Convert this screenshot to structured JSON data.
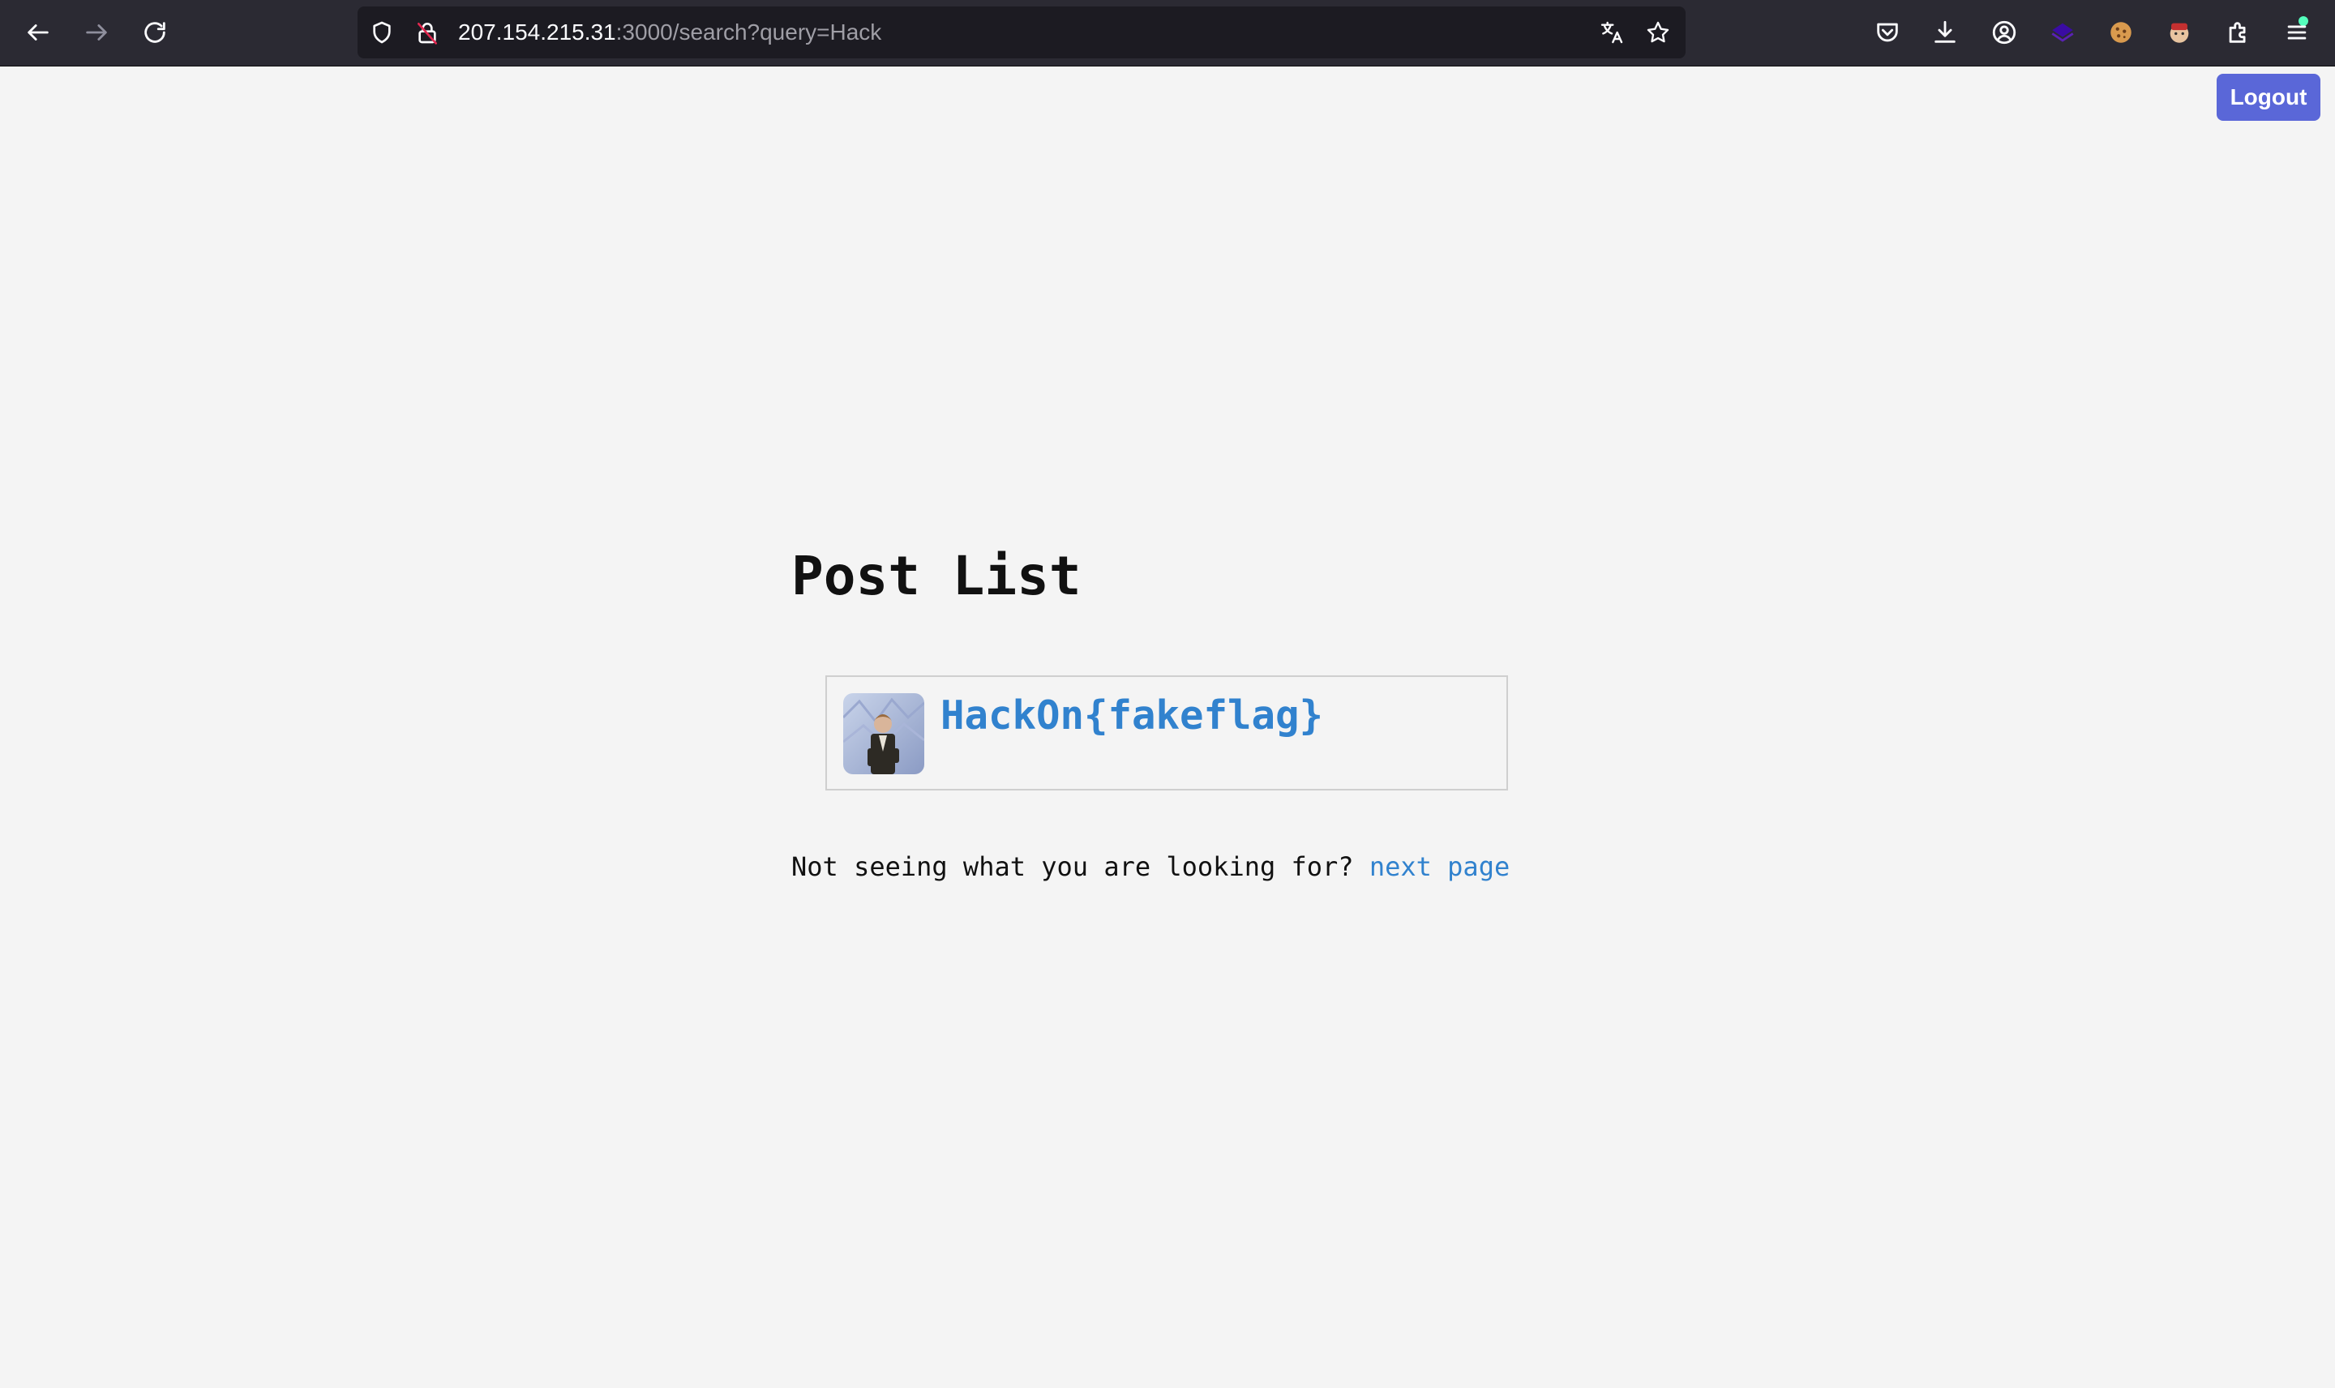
{
  "browser": {
    "url_host": "207.154.215.31",
    "url_rest": ":3000/search?query=Hack",
    "icons": {
      "back": "back-arrow-icon",
      "forward": "forward-arrow-icon",
      "reload": "reload-icon",
      "tracking": "shield-icon",
      "security": "insecure-lock-icon",
      "translate": "translate-icon",
      "bookmark": "star-icon",
      "pocket": "pocket-icon",
      "downloads": "download-icon",
      "account": "account-icon",
      "extensions": [
        "extension-layers-icon",
        "cookie-icon",
        "extension-avatar-icon"
      ],
      "puzzle": "extensions-puzzle-icon",
      "menu": "hamburger-menu-icon"
    }
  },
  "header": {
    "logout_label": "Logout"
  },
  "main": {
    "title": "Post List",
    "posts": [
      {
        "title": "HackOn{fakeflag}",
        "thumbnail": "rick-astley-image"
      }
    ],
    "footer_text": "Not seeing what you are looking for? ",
    "next_link": "next page"
  },
  "colors": {
    "background": "#f4f4f4",
    "link": "#3182ce",
    "button": "#5a67d8",
    "toolbar": "#2b2a33"
  }
}
